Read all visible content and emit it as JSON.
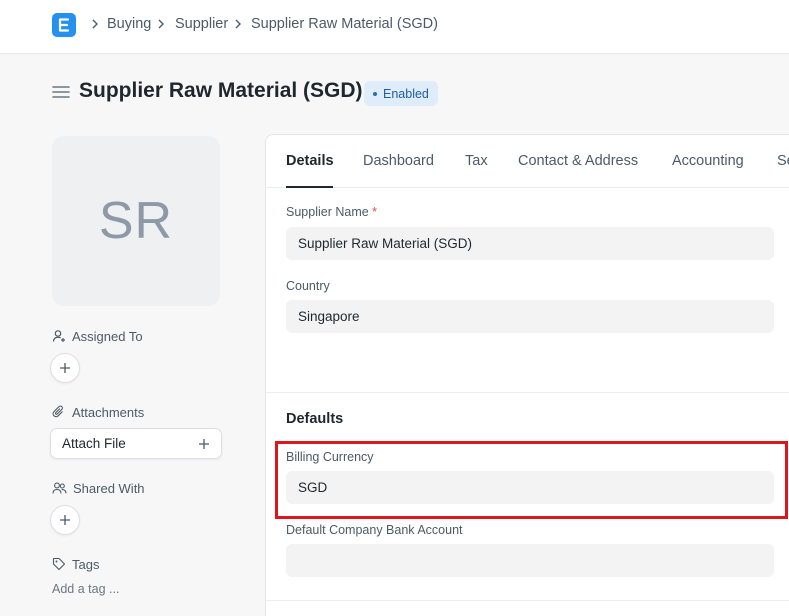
{
  "breadcrumb": {
    "items": [
      "Buying",
      "Supplier",
      "Supplier Raw Material (SGD)"
    ]
  },
  "header": {
    "title": "Supplier Raw Material (SGD)",
    "status": "Enabled"
  },
  "sidebar": {
    "avatar_initials": "SR",
    "assigned_to_label": "Assigned To",
    "attachments_label": "Attachments",
    "attach_file_label": "Attach File",
    "shared_with_label": "Shared With",
    "tags_label": "Tags",
    "add_tag_label": "Add a tag ..."
  },
  "tabs": [
    "Details",
    "Dashboard",
    "Tax",
    "Contact & Address",
    "Accounting",
    "Se"
  ],
  "details": {
    "supplier_name_label": "Supplier Name",
    "supplier_name_required": "*",
    "supplier_name_value": "Supplier Raw Material (SGD)",
    "country_label": "Country",
    "country_value": "Singapore"
  },
  "defaults": {
    "section_title": "Defaults",
    "billing_currency_label": "Billing Currency",
    "billing_currency_value": "SGD",
    "bank_account_label": "Default Company Bank Account",
    "bank_account_value": ""
  },
  "colors": {
    "brand": "#2490ef",
    "highlight": "#e0161e",
    "badge_bg": "#dfecfa",
    "badge_text": "#1f5fa0"
  },
  "icons": [
    "app-logo-icon",
    "chevron-right-icon",
    "hamburger-menu-icon",
    "user-plus-icon",
    "paperclip-icon",
    "users-icon",
    "tag-icon",
    "plus-icon"
  ]
}
